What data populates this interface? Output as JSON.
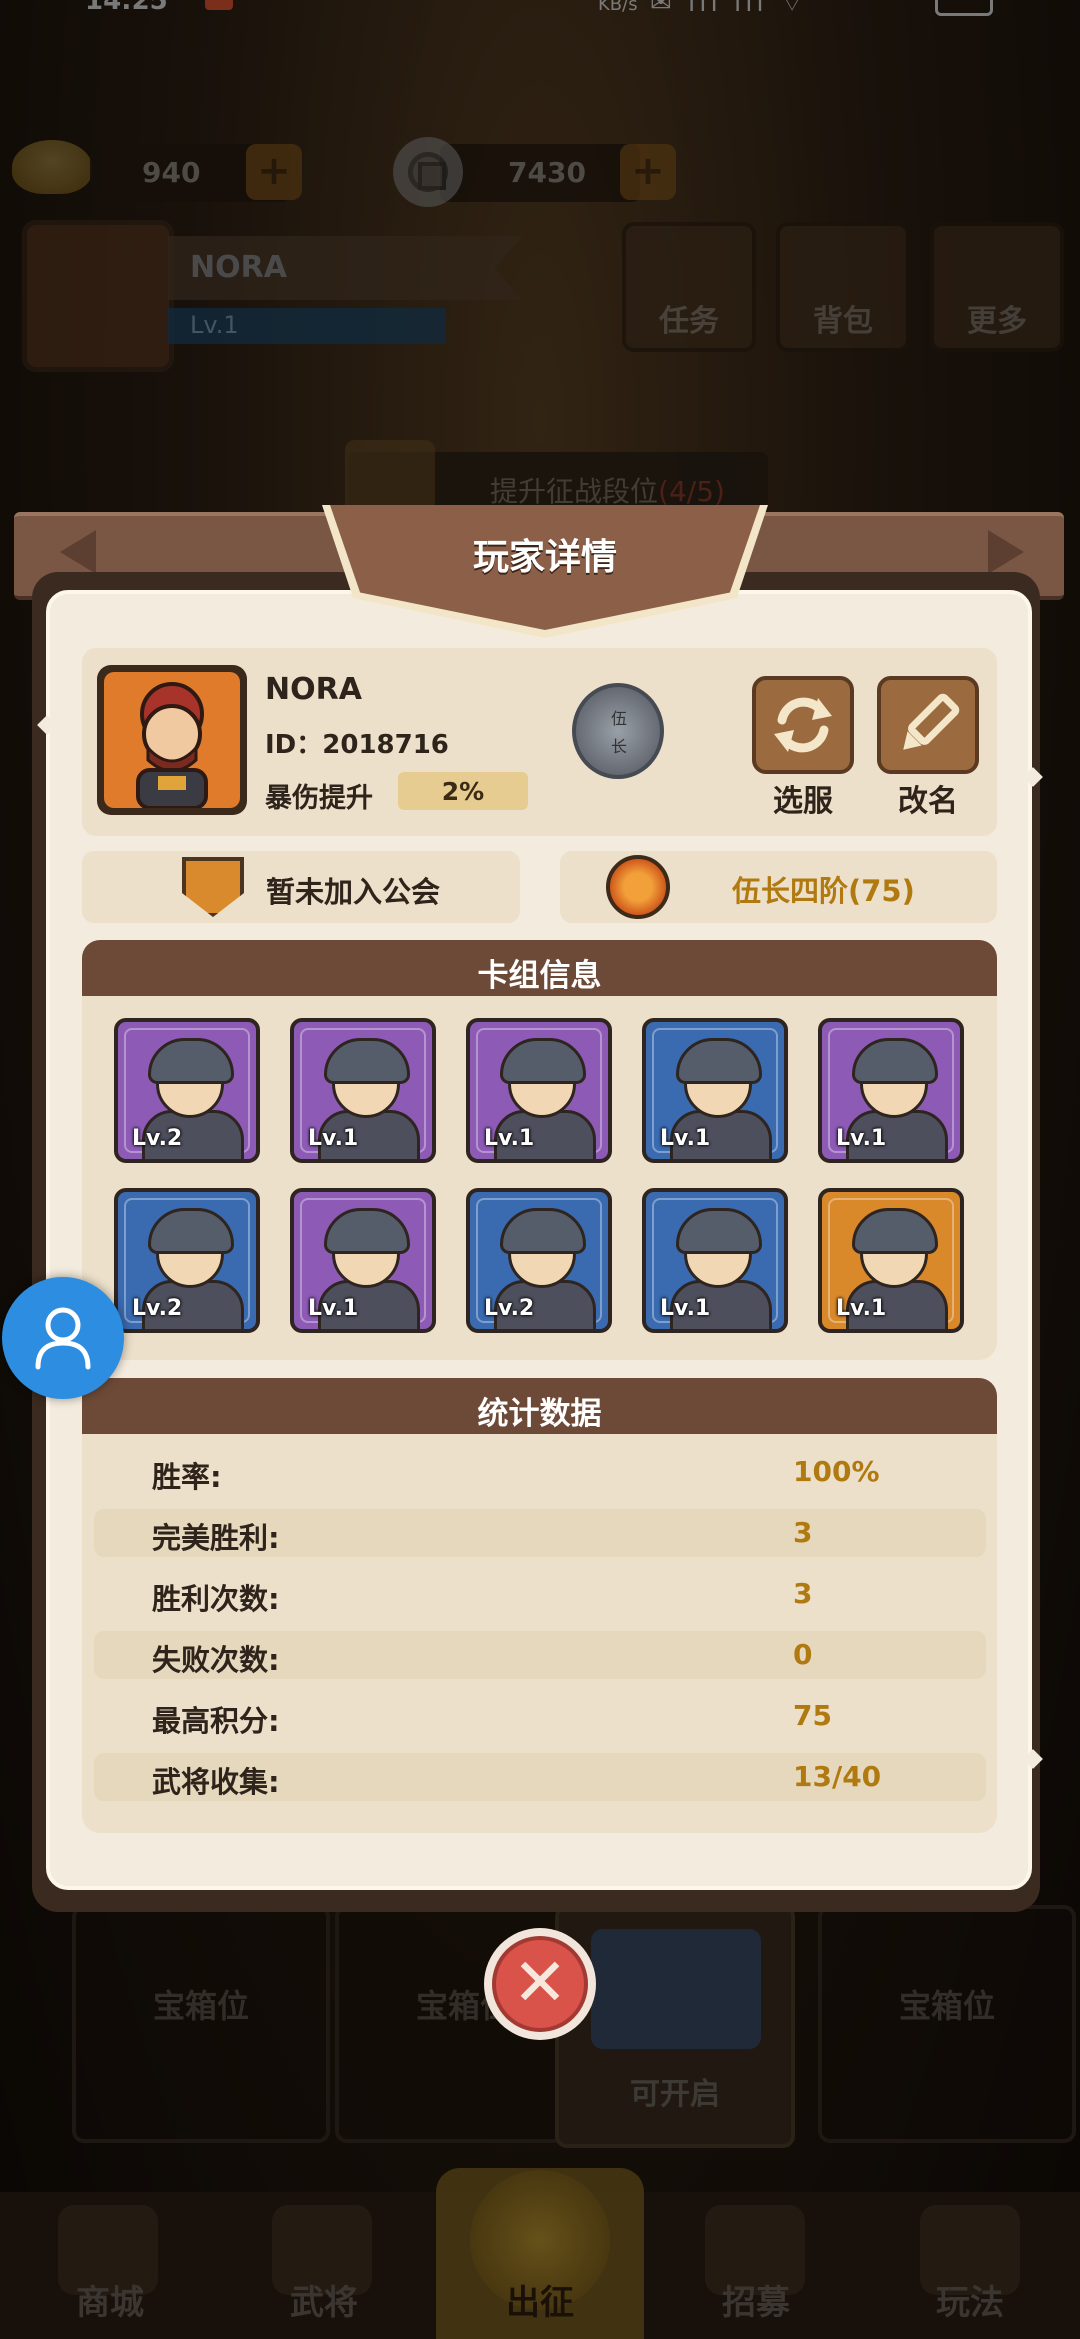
{
  "status_bar": {
    "time": "14:25",
    "speed": "KB/s"
  },
  "hud": {
    "gold": "940",
    "coins": "7430",
    "player_name": "NORA",
    "player_level": "Lv.1",
    "menu": [
      {
        "label": "任务",
        "icon": "scroll-icon"
      },
      {
        "label": "背包",
        "icon": "bag-icon"
      },
      {
        "label": "更多",
        "icon": "list-icon"
      }
    ],
    "quest_text": "提升征战段位",
    "quest_progress": "(4/5)"
  },
  "dialog": {
    "title": "玩家详情",
    "player": {
      "name": "NORA",
      "id": "ID：2018716",
      "crit_label": "暴伤提升",
      "crit_value": "2%",
      "rank_badge": "伍长"
    },
    "actions": [
      {
        "label": "选服",
        "icon": "refresh-icon"
      },
      {
        "label": "改名",
        "icon": "pencil-icon"
      }
    ],
    "guild_text": "暂未加入公会",
    "rank_text": "伍长四阶(75)",
    "deck_title": "卡组信息",
    "cards": [
      {
        "level": "Lv.2",
        "frame": "purple"
      },
      {
        "level": "Lv.1",
        "frame": "purple"
      },
      {
        "level": "Lv.1",
        "frame": "purple"
      },
      {
        "level": "Lv.1",
        "frame": "blue"
      },
      {
        "level": "Lv.1",
        "frame": "purple"
      },
      {
        "level": "Lv.2",
        "frame": "blue"
      },
      {
        "level": "Lv.1",
        "frame": "purple"
      },
      {
        "level": "Lv.2",
        "frame": "blue"
      },
      {
        "level": "Lv.1",
        "frame": "blue"
      },
      {
        "level": "Lv.1",
        "frame": "orange"
      }
    ],
    "stats_title": "统计数据",
    "stats": [
      {
        "label": "胜率:",
        "value": "100%"
      },
      {
        "label": "完美胜利:",
        "value": "3"
      },
      {
        "label": "胜利次数:",
        "value": "3"
      },
      {
        "label": "失败次数:",
        "value": "0"
      },
      {
        "label": "最高积分:",
        "value": "75"
      },
      {
        "label": "武将收集:",
        "value": "13/40"
      }
    ]
  },
  "bottom": {
    "chest_slots": [
      "宝箱位",
      "宝箱位",
      "宝箱位"
    ],
    "chest_open_label": "可开启",
    "nav": [
      "商城",
      "武将",
      "出征",
      "招募",
      "玩法"
    ]
  },
  "colors": {
    "accent": "#b07a10",
    "panel": "#f3ebdd",
    "header": "#6d4a37",
    "close": "#d9534a"
  }
}
